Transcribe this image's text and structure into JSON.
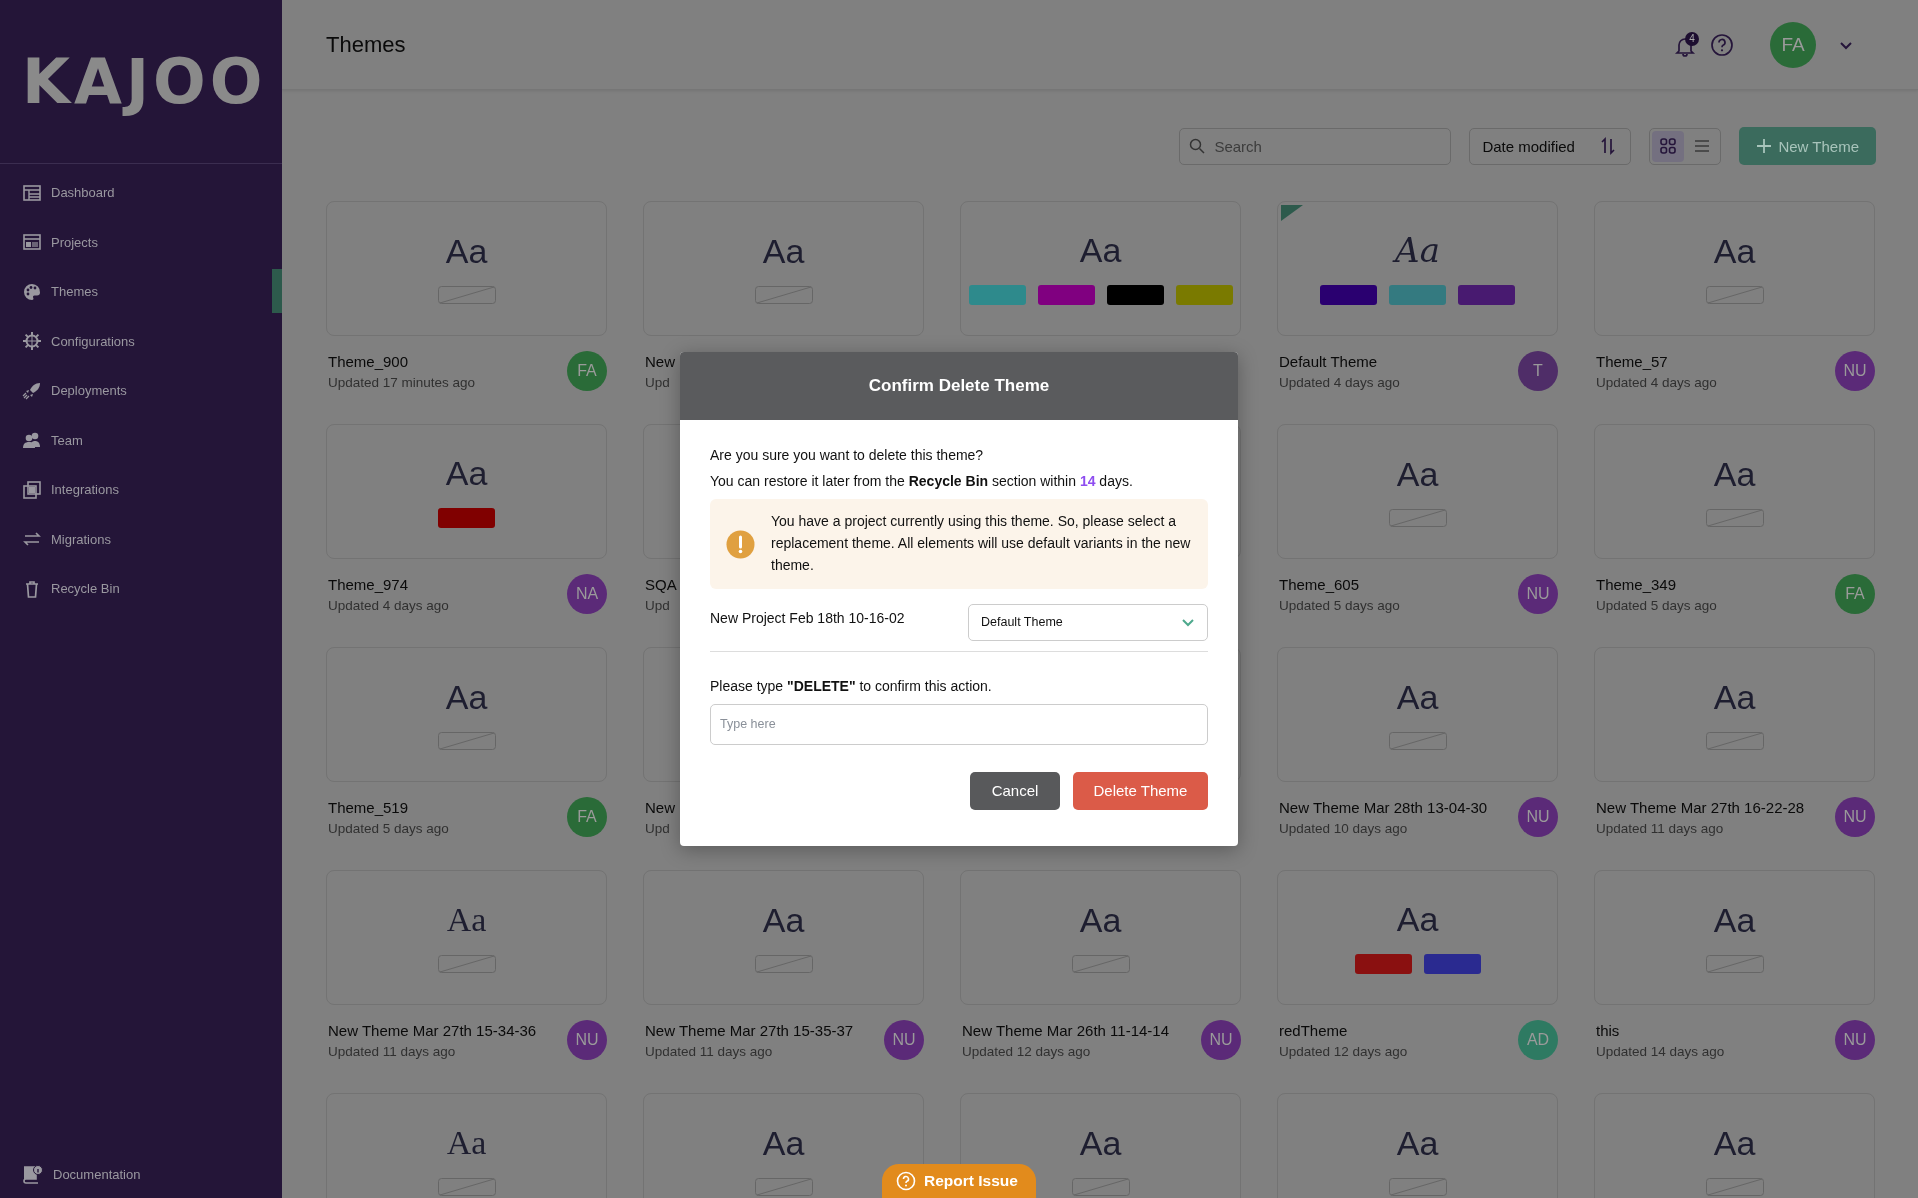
{
  "sidebar": {
    "logo": "KAJOO",
    "items": [
      {
        "label": "Dashboard",
        "selected": false
      },
      {
        "label": "Projects",
        "selected": false
      },
      {
        "label": "Themes",
        "selected": true
      },
      {
        "label": "Configurations",
        "selected": false
      },
      {
        "label": "Deployments",
        "selected": false
      },
      {
        "label": "Team",
        "selected": false
      },
      {
        "label": "Integrations",
        "selected": false
      },
      {
        "label": "Migrations",
        "selected": false
      },
      {
        "label": "Recycle Bin",
        "selected": false
      }
    ],
    "footer": {
      "label": "Documentation"
    }
  },
  "header": {
    "title": "Themes",
    "notification_count": "4",
    "avatar": {
      "initials": "FA",
      "color": "#2a6b38"
    }
  },
  "toolbar": {
    "search": {
      "placeholder": "Search"
    },
    "sort": {
      "label": "Date modified"
    },
    "views": [
      {
        "kind": "grid",
        "selected": true
      },
      {
        "kind": "list",
        "selected": false
      }
    ],
    "new_button": "New Theme"
  },
  "cards": [
    {
      "title": "Theme_900",
      "updated": "Updated 17 minutes ago",
      "default": false,
      "avatar": {
        "initials": "FA",
        "color": "#2a6b38"
      },
      "preview": {
        "kind": "plain",
        "glyph": "Aa"
      }
    },
    {
      "title": "New",
      "updated": "Upd",
      "default": false,
      "preview": {
        "kind": "plain",
        "glyph": "Aa"
      }
    },
    {
      "default": false,
      "preview": {
        "kind": "swatches",
        "glyph": "Aa",
        "swatches": [
          {
            "color": "#2e8a8c"
          },
          {
            "color": "#800080"
          },
          {
            "color": "#000000"
          },
          {
            "color": "#7a7a00"
          }
        ]
      }
    },
    {
      "title": "Default Theme",
      "updated": "Updated 4 days ago",
      "default": true,
      "avatar": {
        "initials": "T",
        "color": "#4f2d68"
      },
      "preview": {
        "kind": "script",
        "glyph": "Aa",
        "swatches": [
          {
            "color": "#2a0070"
          },
          {
            "color": "#347a80"
          },
          {
            "color": "#481a70"
          }
        ]
      }
    },
    {
      "title": "Theme_57",
      "updated": "Updated 4 days ago",
      "default": false,
      "avatar": {
        "initials": "NU",
        "color": "#5b2a78"
      },
      "preview": {
        "kind": "plain",
        "glyph": "Aa"
      }
    },
    {
      "title": "Theme_974",
      "updated": "Updated 4 days ago",
      "default": false,
      "avatar": {
        "initials": "NA",
        "color": "#5b2a78"
      },
      "preview": {
        "kind": "swatches",
        "glyph": "Aa",
        "swatches": [
          {
            "color": "#800000"
          }
        ]
      }
    },
    {
      "title": "SQA",
      "updated": "Upd",
      "preview": {
        "kind": "covered"
      }
    },
    {
      "preview": {
        "kind": "covered"
      }
    },
    {
      "title": "Theme_605",
      "updated": "Updated 5 days ago",
      "default": false,
      "avatar": {
        "initials": "NU",
        "color": "#5b2a78"
      },
      "preview": {
        "kind": "plain",
        "glyph": "Aa"
      }
    },
    {
      "title": "Theme_349",
      "updated": "Updated 5 days ago",
      "default": false,
      "avatar": {
        "initials": "FA",
        "color": "#2a6b38"
      },
      "preview": {
        "kind": "plain",
        "glyph": "Aa"
      }
    },
    {
      "title": "Theme_519",
      "updated": "Updated 5 days ago",
      "default": false,
      "avatar": {
        "initials": "FA",
        "color": "#2a6b38"
      },
      "preview": {
        "kind": "plain",
        "glyph": "Aa"
      }
    },
    {
      "title": "New",
      "updated": "Upd",
      "preview": {
        "kind": "covered"
      }
    },
    {
      "preview": {
        "kind": "covered"
      }
    },
    {
      "title": "New Theme Mar 28th 13-04-30",
      "updated": "Updated 10 days ago",
      "default": false,
      "avatar": {
        "initials": "NU",
        "color": "#5b2a78"
      },
      "preview": {
        "kind": "plain",
        "glyph": "Aa"
      }
    },
    {
      "title": "New Theme Mar 27th 16-22-28",
      "updated": "Updated 11 days ago",
      "default": false,
      "avatar": {
        "initials": "NU",
        "color": "#5b2a78"
      },
      "preview": {
        "kind": "plain",
        "glyph": "Aa"
      }
    },
    {
      "title": "New Theme Mar 27th 15-34-36",
      "updated": "Updated 11 days ago",
      "default": false,
      "avatar": {
        "initials": "NU",
        "color": "#5b2a78"
      },
      "preview": {
        "kind": "serif",
        "glyph": "Aa"
      }
    },
    {
      "title": "New Theme Mar 27th 15-35-37",
      "updated": "Updated 11 days ago",
      "default": false,
      "avatar": {
        "initials": "NU",
        "color": "#5b2a78"
      },
      "preview": {
        "kind": "plain",
        "glyph": "Aa"
      }
    },
    {
      "title": "New Theme Mar 26th 11-14-14",
      "updated": "Updated 12 days ago",
      "default": false,
      "avatar": {
        "initials": "NU",
        "color": "#5b2a78"
      },
      "preview": {
        "kind": "plain",
        "glyph": "Aa"
      }
    },
    {
      "title": "redTheme",
      "updated": "Updated 12 days ago",
      "default": false,
      "avatar": {
        "initials": "AD",
        "color": "#2e7a62"
      },
      "preview": {
        "kind": "swatches",
        "glyph": "Aa",
        "swatches": [
          {
            "color": "#8a1010"
          },
          {
            "color": "#2a2a90"
          }
        ]
      }
    },
    {
      "title": "this",
      "updated": "Updated 14 days ago",
      "default": false,
      "avatar": {
        "initials": "NU",
        "color": "#5b2a78"
      },
      "preview": {
        "kind": "plain",
        "glyph": "Aa"
      }
    },
    {
      "default": false,
      "preview": {
        "kind": "serif",
        "glyph": "Aa"
      }
    },
    {
      "default": false,
      "preview": {
        "kind": "plain",
        "glyph": "Aa"
      }
    },
    {
      "default": false,
      "preview": {
        "kind": "plain",
        "glyph": "Aa"
      }
    },
    {
      "default": false,
      "preview": {
        "kind": "plain",
        "glyph": "Aa"
      }
    },
    {
      "default": false,
      "preview": {
        "kind": "plain",
        "glyph": "Aa"
      }
    }
  ],
  "dialog": {
    "title": "Confirm Delete Theme",
    "question": "Are you sure you want to delete this theme?",
    "restore_note": {
      "text": "You can restore it later from the **Recycle Bin** section within ",
      "days": "14",
      "suffix": " days."
    },
    "warning": "You have a project currently using this theme. So, please select a replacement theme. All elements will use default variants in the new theme.",
    "project": {
      "name": "New Project Feb 18th 10-16-02",
      "replacement": "Default Theme"
    },
    "confirm_prompt": "Please type **\"DELETE\"** to confirm this action.",
    "confirm_input": {
      "placeholder": "Type here"
    },
    "buttons": [
      {
        "label": "Cancel",
        "kind": "secondary"
      },
      {
        "label": "Delete Theme",
        "kind": "danger"
      }
    ]
  },
  "report_button": "Report Issue"
}
